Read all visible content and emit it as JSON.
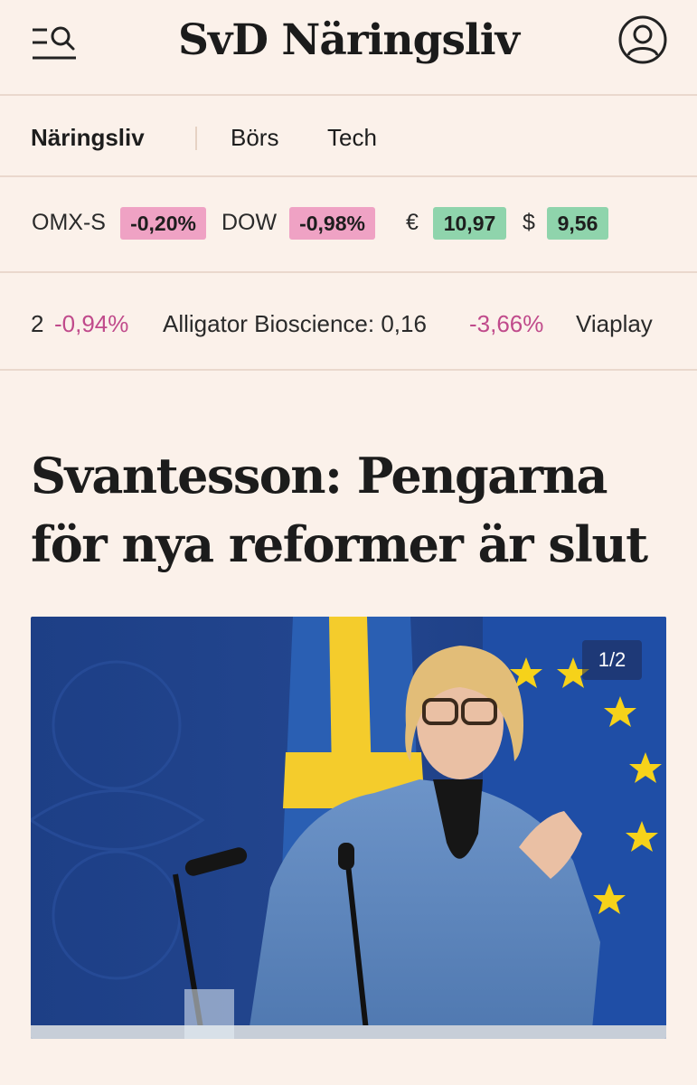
{
  "header": {
    "brand": "SvD Näringsliv",
    "menu_icon": "menu-search-icon",
    "account_icon": "user-icon"
  },
  "section_nav": {
    "items": [
      {
        "label": "Näringsliv",
        "active": true
      },
      {
        "label": "Börs",
        "active": false
      },
      {
        "label": "Tech",
        "active": false
      }
    ]
  },
  "market": {
    "omx_label": "OMX-S",
    "omx_change": "-0,20%",
    "dow_label": "DOW",
    "dow_change": "-0,98%",
    "eur_symbol": "€",
    "eur_value": "10,97",
    "usd_symbol": "$",
    "usd_value": "9,56",
    "colors": {
      "negative": "#efa2c4",
      "positive": "#8fd4ac"
    }
  },
  "stocks": {
    "prev_fragment": "2",
    "prev_change": "-0,94%",
    "item_name": "Alligator Bioscience: 0,16",
    "item_change": "-3,66%",
    "next_name": "Viaplay",
    "negative_color": "#c04a8b"
  },
  "article": {
    "headline": "Svantesson: Pengarna för nya reformer är slut",
    "image_counter": "1/2"
  }
}
